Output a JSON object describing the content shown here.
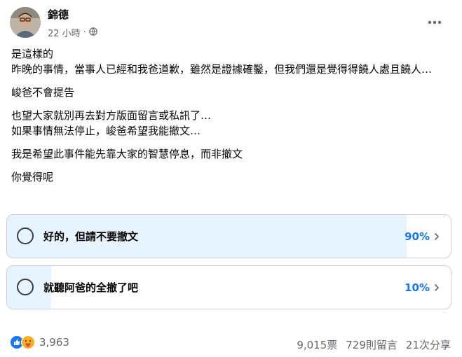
{
  "post": {
    "author": "錦德",
    "time": "22 小時",
    "separator": "·",
    "privacy_icon": "globe-icon"
  },
  "content": [
    "是這樣的",
    "昨晚的事情，當事人已經和我爸道歉，雖然是證據確鑿，但我們還是覺得得饒人處且饒人…",
    "峻爸不會提告",
    "也望大家就別再去對方版面留言或私訊了…",
    "如果事情無法停止，峻爸希望我能撤文…",
    "我是希望此事件能先靠大家的智慧停息，而非撤文",
    "你覺得呢"
  ],
  "poll": {
    "options": [
      {
        "label": "好的，但請不要撤文",
        "percent_text": "90%",
        "percent": 0.9
      },
      {
        "label": "就聽阿爸的全撤了吧",
        "percent_text": "10%",
        "percent": 0.1
      }
    ]
  },
  "footer": {
    "reactions_count": "3,963",
    "reaction_icons": [
      "like-icon",
      "care-icon"
    ],
    "votes": "9,015票",
    "comments": "729則留言",
    "shares": "21次分享"
  },
  "colors": {
    "accent": "#1877f2",
    "poll_fill": "#e7f3ff",
    "muted": "#65676b"
  }
}
